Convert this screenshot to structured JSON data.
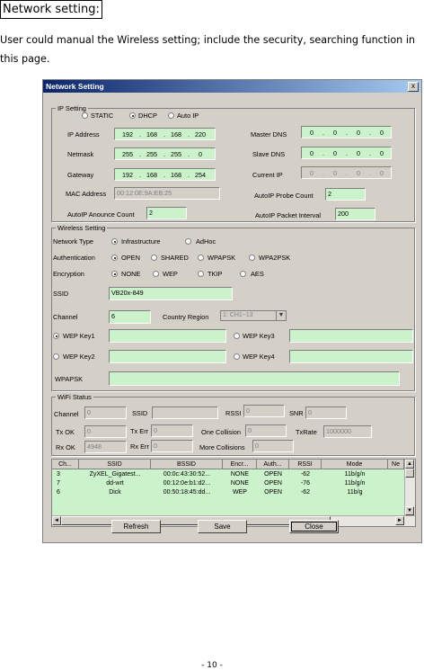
{
  "heading": "Network setting:",
  "description": "User could manual the Wireless setting; include the security, searching function in this page.",
  "page_number": "- 10 -",
  "dialog": {
    "title": "Network Setting",
    "close": "x",
    "ip_setting": {
      "label": "IP Setting",
      "modes": [
        "STATIC",
        "DHCP",
        "Auto IP"
      ],
      "selected_mode": "DHCP",
      "ip_address_label": "IP Address",
      "ip_address": [
        "192",
        "168",
        "168",
        "220"
      ],
      "netmask_label": "Netmask",
      "netmask": [
        "255",
        "255",
        "255",
        "0"
      ],
      "gateway_label": "Gateway",
      "gateway": [
        "192",
        "168",
        "168",
        "254"
      ],
      "mac_label": "MAC Address",
      "mac": "00:12:0E:9A:EB:25",
      "master_dns_label": "Master DNS",
      "master_dns": [
        "0",
        "0",
        "0",
        "0"
      ],
      "slave_dns_label": "Slave DNS",
      "slave_dns": [
        "0",
        "0",
        "0",
        "0"
      ],
      "current_ip_label": "Current IP",
      "current_ip": [
        "0",
        "0",
        "0",
        "0"
      ],
      "probe_label": "AutoIP Probe Count",
      "probe": "2",
      "announce_label": "AutoIP Anounce Count",
      "announce": "2",
      "packet_label": "AutoIP Packet Interval",
      "packet": "200"
    },
    "wireless": {
      "label": "Wireless Setting",
      "network_type_label": "Network Type",
      "network_types": [
        "Infrastructure",
        "AdHoc"
      ],
      "auth_label": "Authentication",
      "auth_options": [
        "OPEN",
        "SHARED",
        "WPAPSK",
        "WPA2PSK"
      ],
      "enc_label": "Encryption",
      "enc_options": [
        "NONE",
        "WEP",
        "TKIP",
        "AES"
      ],
      "ssid_label": "SSID",
      "ssid": "VB20x-849",
      "channel_label": "Channel",
      "channel": "6",
      "country_label": "Country Region",
      "country": "1: CH1~13",
      "select_arrow": "▼",
      "wep_key1": "WEP Key1",
      "wep_key2": "WEP Key2",
      "wep_key3": "WEP Key3",
      "wep_key4": "WEP Key4",
      "wpapsk_label": "WPAPSK"
    },
    "status": {
      "label": "WiFi Status",
      "channel_label": "Channel",
      "channel": "0",
      "ssid_label": "SSID",
      "ssid": "",
      "rssi_label": "RSSI",
      "rssi": "0",
      "snr_label": "SNR",
      "snr": "0",
      "txok_label": "Tx OK",
      "txok": "0",
      "txerr_label": "Tx Err",
      "txerr": "0",
      "onecol_label": "One Collision",
      "onecol": "0",
      "txrate_label": "TxRate",
      "txrate": "1000000",
      "rxok_label": "Rx OK",
      "rxok": "4948",
      "rxerr_label": "Rx Err",
      "rxerr": "0",
      "morecol_label": "More Collisions",
      "morecol": "0"
    },
    "table": {
      "columns": [
        "Ch...",
        "SSID",
        "BSSID",
        "Encr...",
        "Auth...",
        "RSSI",
        "Mode",
        "Ne"
      ],
      "rows": [
        [
          "3",
          "ZyXEL_Gigatest...",
          "00:0c:43:30:52...",
          "NONE",
          "OPEN",
          "-62",
          "11b/g/n",
          ""
        ],
        [
          "7",
          "dd-wrt",
          "00:12:0e:b1:d2...",
          "NONE",
          "OPEN",
          "-76",
          "11b/g/n",
          ""
        ],
        [
          "6",
          "Dick",
          "00:50:18:45:dd...",
          "WEP",
          "OPEN",
          "-62",
          "11b/g",
          ""
        ]
      ],
      "scroll_up": "▲",
      "scroll_down": "▼",
      "scroll_left": "◄",
      "scroll_right": "►"
    },
    "buttons": {
      "refresh": "Refresh",
      "save": "Save",
      "close": "Close"
    }
  }
}
